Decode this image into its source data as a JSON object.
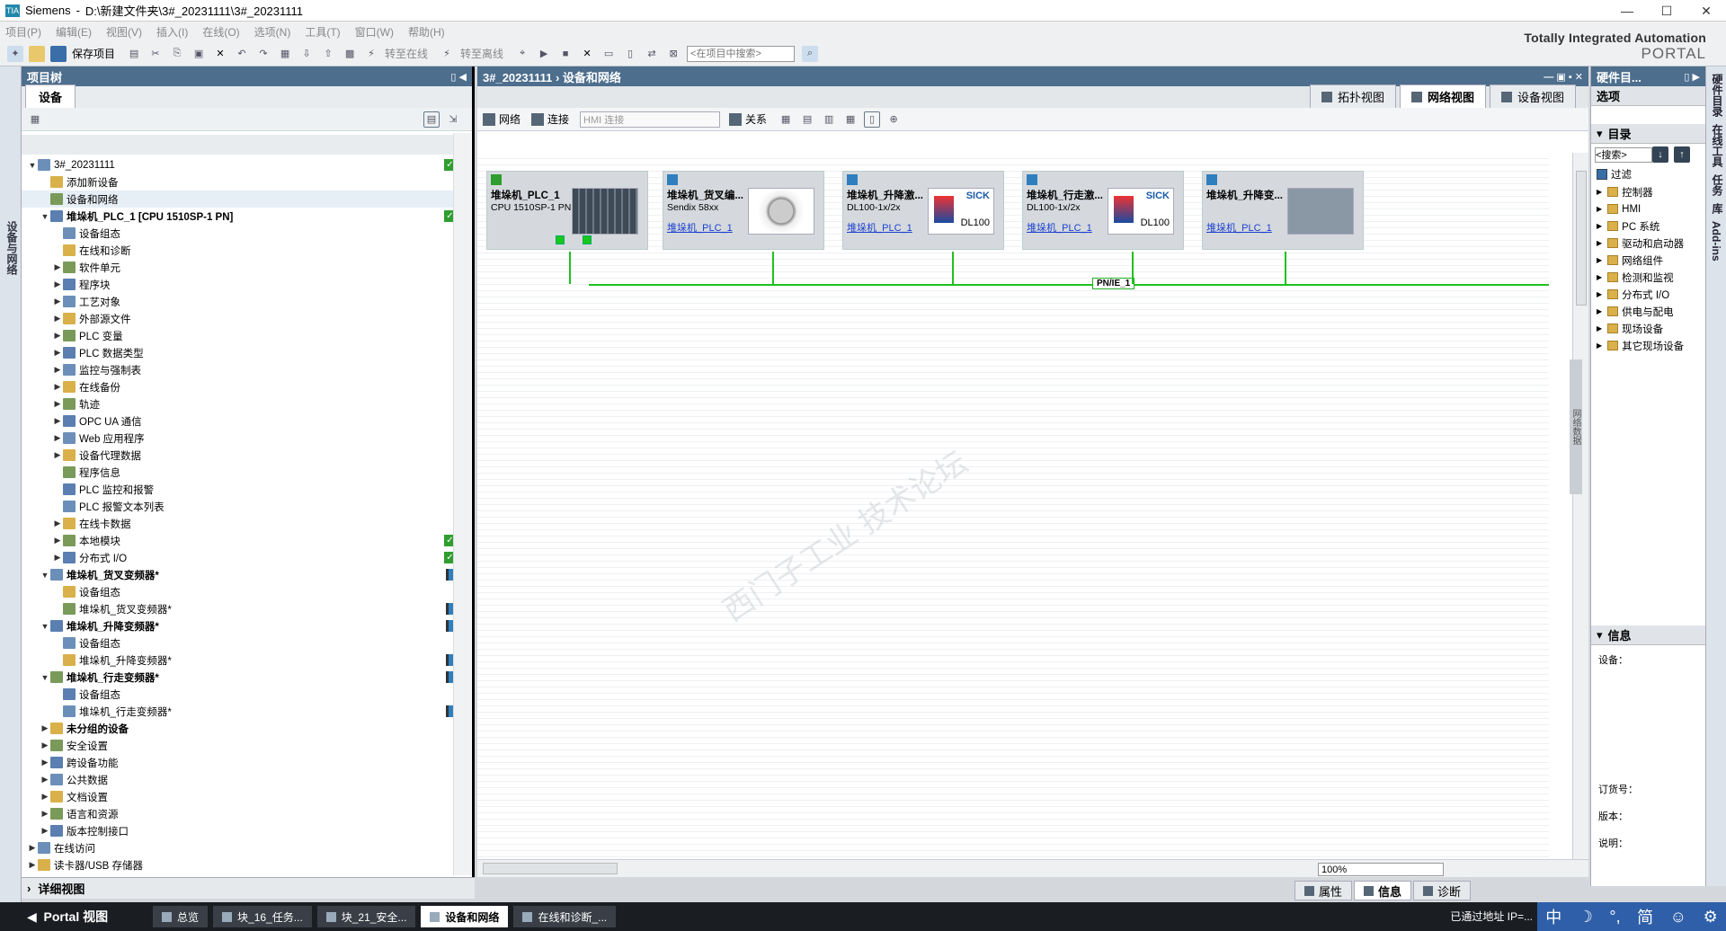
{
  "window": {
    "app": "Siemens",
    "path": "D:\\新建文件夹\\3#_20231111\\3#_20231111",
    "brand_line1": "Totally Integrated Automation",
    "brand_line2": "PORTAL"
  },
  "menu": [
    "项目(P)",
    "编辑(E)",
    "视图(V)",
    "插入(I)",
    "在线(O)",
    "选项(N)",
    "工具(T)",
    "窗口(W)",
    "帮助(H)"
  ],
  "toolbar": {
    "save_label": "保存项目",
    "go_online": "转至在线",
    "go_offline": "转至离线",
    "search_placeholder": "<在项目中搜索>"
  },
  "left_strip": "设备与网络",
  "project_tree": {
    "title": "项目树",
    "tab": "设备",
    "rows": [
      {
        "label": "3#_20231111",
        "indent": 0,
        "arrow": "▼",
        "bold": false,
        "st": "check,dot"
      },
      {
        "label": "添加新设备",
        "indent": 1,
        "arrow": "",
        "bold": false,
        "st": ""
      },
      {
        "label": "设备和网络",
        "indent": 1,
        "arrow": "",
        "bold": false,
        "st": "",
        "sel": true
      },
      {
        "label": "堆垛机_PLC_1 [CPU 1510SP-1 PN]",
        "indent": 1,
        "arrow": "▼",
        "bold": true,
        "st": "check,dot"
      },
      {
        "label": "设备组态",
        "indent": 2,
        "arrow": "",
        "bold": false,
        "st": ""
      },
      {
        "label": "在线和诊断",
        "indent": 2,
        "arrow": "",
        "bold": false,
        "st": ""
      },
      {
        "label": "软件单元",
        "indent": 2,
        "arrow": "▶",
        "bold": false,
        "st": ""
      },
      {
        "label": "程序块",
        "indent": 2,
        "arrow": "▶",
        "bold": false,
        "st": "dot"
      },
      {
        "label": "工艺对象",
        "indent": 2,
        "arrow": "▶",
        "bold": false,
        "st": ""
      },
      {
        "label": "外部源文件",
        "indent": 2,
        "arrow": "▶",
        "bold": false,
        "st": ""
      },
      {
        "label": "PLC 变量",
        "indent": 2,
        "arrow": "▶",
        "bold": false,
        "st": "dot"
      },
      {
        "label": "PLC 数据类型",
        "indent": 2,
        "arrow": "▶",
        "bold": false,
        "st": "dot"
      },
      {
        "label": "监控与强制表",
        "indent": 2,
        "arrow": "▶",
        "bold": false,
        "st": ""
      },
      {
        "label": "在线备份",
        "indent": 2,
        "arrow": "▶",
        "bold": false,
        "st": ""
      },
      {
        "label": "轨迹",
        "indent": 2,
        "arrow": "▶",
        "bold": false,
        "st": ""
      },
      {
        "label": "OPC UA 通信",
        "indent": 2,
        "arrow": "▶",
        "bold": false,
        "st": ""
      },
      {
        "label": "Web 应用程序",
        "indent": 2,
        "arrow": "▶",
        "bold": false,
        "st": ""
      },
      {
        "label": "设备代理数据",
        "indent": 2,
        "arrow": "▶",
        "bold": false,
        "st": ""
      },
      {
        "label": "程序信息",
        "indent": 2,
        "arrow": "",
        "bold": false,
        "st": ""
      },
      {
        "label": "PLC 监控和报警",
        "indent": 2,
        "arrow": "",
        "bold": false,
        "st": ""
      },
      {
        "label": "PLC 报警文本列表",
        "indent": 2,
        "arrow": "",
        "bold": false,
        "st": ""
      },
      {
        "label": "在线卡数据",
        "indent": 2,
        "arrow": "▶",
        "bold": false,
        "st": ""
      },
      {
        "label": "本地模块",
        "indent": 2,
        "arrow": "▶",
        "bold": false,
        "st": "check"
      },
      {
        "label": "分布式 I/O",
        "indent": 2,
        "arrow": "▶",
        "bold": false,
        "st": "check"
      },
      {
        "label": "堆垛机_货叉变频器*",
        "indent": 1,
        "arrow": "▼",
        "bold": true,
        "st": "net"
      },
      {
        "label": "设备组态",
        "indent": 2,
        "arrow": "",
        "bold": false,
        "st": ""
      },
      {
        "label": "堆垛机_货叉变频器*",
        "indent": 2,
        "arrow": "",
        "bold": false,
        "st": "net"
      },
      {
        "label": "堆垛机_升降变频器*",
        "indent": 1,
        "arrow": "▼",
        "bold": true,
        "st": "net"
      },
      {
        "label": "设备组态",
        "indent": 2,
        "arrow": "",
        "bold": false,
        "st": ""
      },
      {
        "label": "堆垛机_升降变频器*",
        "indent": 2,
        "arrow": "",
        "bold": false,
        "st": "net"
      },
      {
        "label": "堆垛机_行走变频器*",
        "indent": 1,
        "arrow": "▼",
        "bold": true,
        "st": "net"
      },
      {
        "label": "设备组态",
        "indent": 2,
        "arrow": "",
        "bold": false,
        "st": ""
      },
      {
        "label": "堆垛机_行走变频器*",
        "indent": 2,
        "arrow": "",
        "bold": false,
        "st": "net"
      },
      {
        "label": "未分组的设备",
        "indent": 1,
        "arrow": "▶",
        "bold": true,
        "st": ""
      },
      {
        "label": "安全设置",
        "indent": 1,
        "arrow": "▶",
        "bold": false,
        "st": ""
      },
      {
        "label": "跨设备功能",
        "indent": 1,
        "arrow": "▶",
        "bold": false,
        "st": ""
      },
      {
        "label": "公共数据",
        "indent": 1,
        "arrow": "▶",
        "bold": false,
        "st": ""
      },
      {
        "label": "文档设置",
        "indent": 1,
        "arrow": "▶",
        "bold": false,
        "st": ""
      },
      {
        "label": "语言和资源",
        "indent": 1,
        "arrow": "▶",
        "bold": false,
        "st": ""
      },
      {
        "label": "版本控制接口",
        "indent": 1,
        "arrow": "▶",
        "bold": false,
        "st": ""
      },
      {
        "label": "在线访问",
        "indent": 0,
        "arrow": "▶",
        "bold": false,
        "st": ""
      },
      {
        "label": "读卡器/USB 存储器",
        "indent": 0,
        "arrow": "▶",
        "bold": false,
        "st": ""
      }
    ],
    "detail_view": "详细视图"
  },
  "center": {
    "breadcrumb": "3#_20231111  ›  设备和网络",
    "view_tabs": [
      "拓扑视图",
      "网络视图",
      "设备视图"
    ],
    "tool": {
      "network": "网络",
      "connect": "连接",
      "hmi_conn": "HMI 连接",
      "relation": "关系"
    },
    "devices": [
      {
        "name": "堆垛机_PLC_1",
        "type": "CPU 1510SP-1 PN",
        "plc": "",
        "pic": "cpu"
      },
      {
        "name": "堆垛机_货叉编...",
        "type": "Sendix 58xx",
        "plc": "堆垛机_PLC_1",
        "pic": "enc"
      },
      {
        "name": "堆垛机_升降激...",
        "type": "DL100-1x/2x",
        "plc": "堆垛机_PLC_1",
        "pic": "sick"
      },
      {
        "name": "堆垛机_行走激...",
        "type": "DL100-1x/2x",
        "plc": "堆垛机_PLC_1",
        "pic": "sick"
      },
      {
        "name": "堆垛机_升降变...",
        "type": "",
        "plc": "堆垛机_PLC_1",
        "pic": "drv"
      }
    ],
    "sick_brand": "SICK",
    "sick_model": "DL100",
    "subnet": "PN/IE_1",
    "zoom": "100%",
    "side_collapsed": "网络数据"
  },
  "right": {
    "title": "硬件目...",
    "options": "选项",
    "catalog": "目录",
    "search": "<搜索>",
    "filter": "过滤",
    "items": [
      "控制器",
      "HMI",
      "PC 系统",
      "驱动和启动器",
      "网络组件",
      "检测和监视",
      "分布式 I/O",
      "供电与配电",
      "现场设备",
      "其它现场设备"
    ],
    "info": "信息",
    "device_label": "设备：",
    "order_label": "订货号：",
    "version_label": "版本：",
    "desc_label": "说明：",
    "strip": [
      "硬件目录",
      "在线工具",
      "任务",
      "库",
      "Add-ins"
    ]
  },
  "bottom_tabs": [
    "属性",
    "信息",
    "诊断"
  ],
  "taskbar": {
    "portal": "Portal 视图",
    "items": [
      "总览",
      "块_16_任务...",
      "块_21_安全...",
      "设备和网络",
      "在线和诊断_..."
    ],
    "status": "已通过地址 IP=..."
  },
  "ime": [
    "中",
    "简"
  ]
}
